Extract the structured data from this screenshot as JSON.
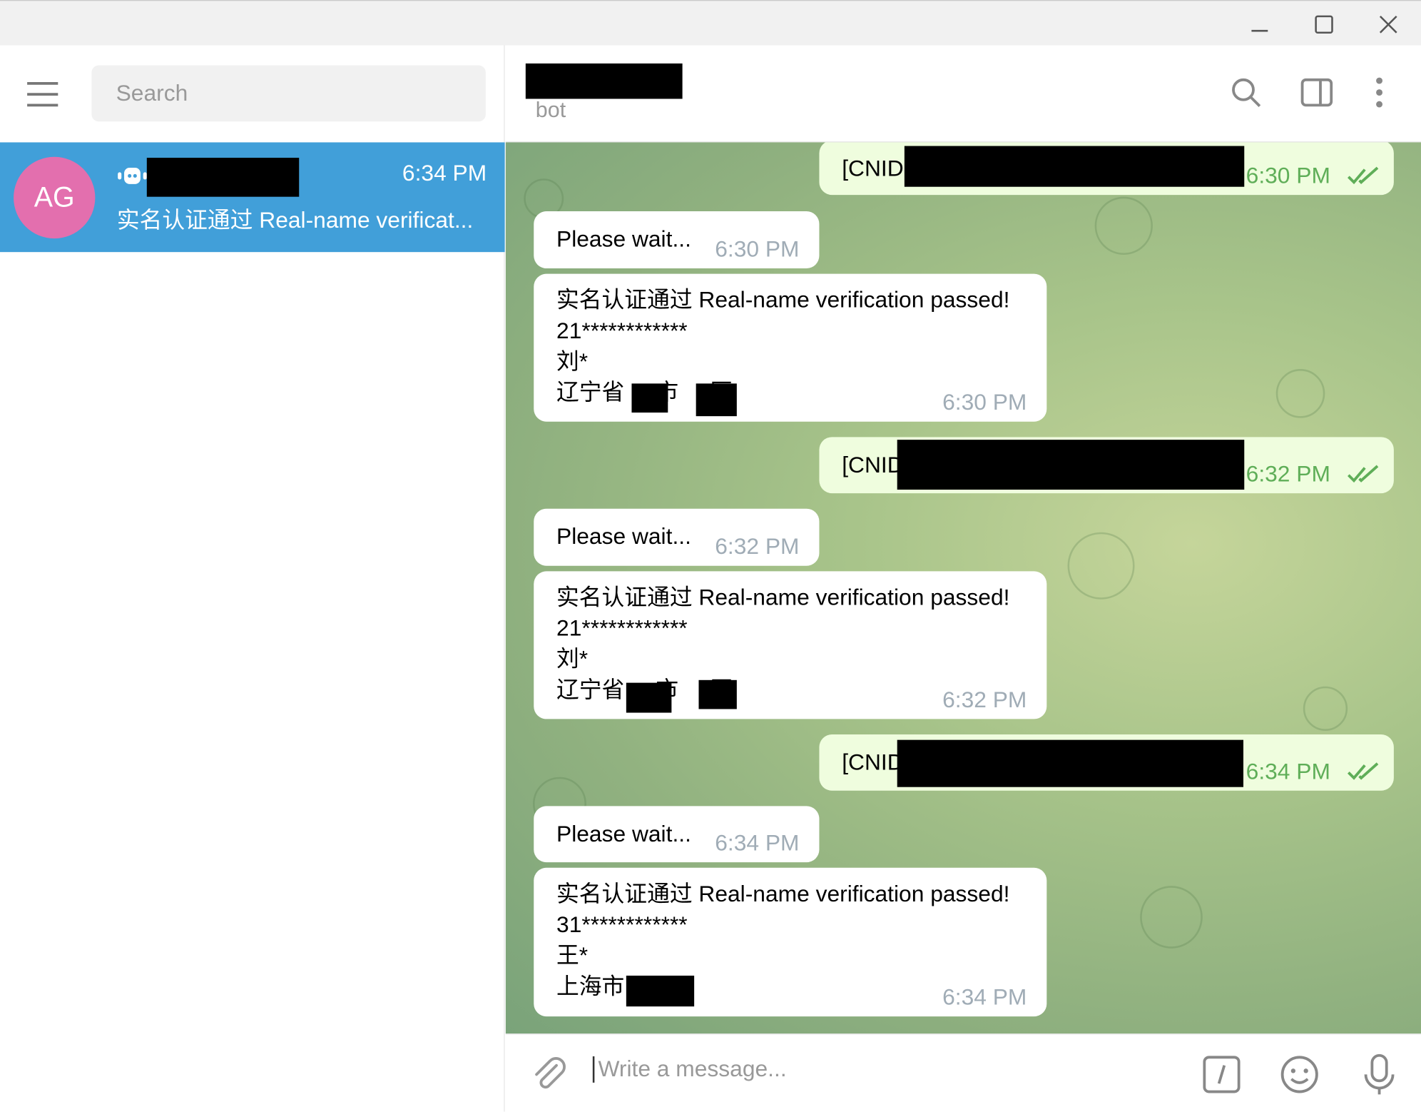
{
  "window": {
    "minimize_icon": "minimize-icon",
    "maximize_icon": "maximize-icon",
    "close_icon": "close-icon"
  },
  "sidebar": {
    "search_placeholder": "Search",
    "chats": [
      {
        "avatar_initials": "AG",
        "time": "6:34 PM",
        "preview": "实名认证通过 Real-name verificat..."
      }
    ]
  },
  "header": {
    "subtitle": "bot"
  },
  "messages": [
    {
      "dir": "out",
      "text": "[CNID",
      "time": "6:30 PM"
    },
    {
      "dir": "in",
      "text": "Please wait...",
      "time": "6:30 PM"
    },
    {
      "dir": "in",
      "lines": [
        "实名认证通过 Real-name verification passed!",
        "21************",
        "刘*",
        "辽宁省     市     区"
      ],
      "time": "6:30 PM"
    },
    {
      "dir": "out",
      "text": "[CNID",
      "time": "6:32 PM"
    },
    {
      "dir": "in",
      "text": "Please wait...",
      "time": "6:32 PM"
    },
    {
      "dir": "in",
      "lines": [
        "实名认证通过 Real-name verification passed!",
        "21************",
        "刘*",
        "辽宁省     市     区"
      ],
      "time": "6:32 PM"
    },
    {
      "dir": "out",
      "text": "[CNID",
      "time": "6:34 PM"
    },
    {
      "dir": "in",
      "text": "Please wait...",
      "time": "6:34 PM"
    },
    {
      "dir": "in",
      "lines": [
        "实名认证通过 Real-name verification passed!",
        "31************",
        "王*",
        "上海市       区"
      ],
      "time": "6:34 PM"
    }
  ],
  "composer": {
    "placeholder": "Write a message..."
  }
}
